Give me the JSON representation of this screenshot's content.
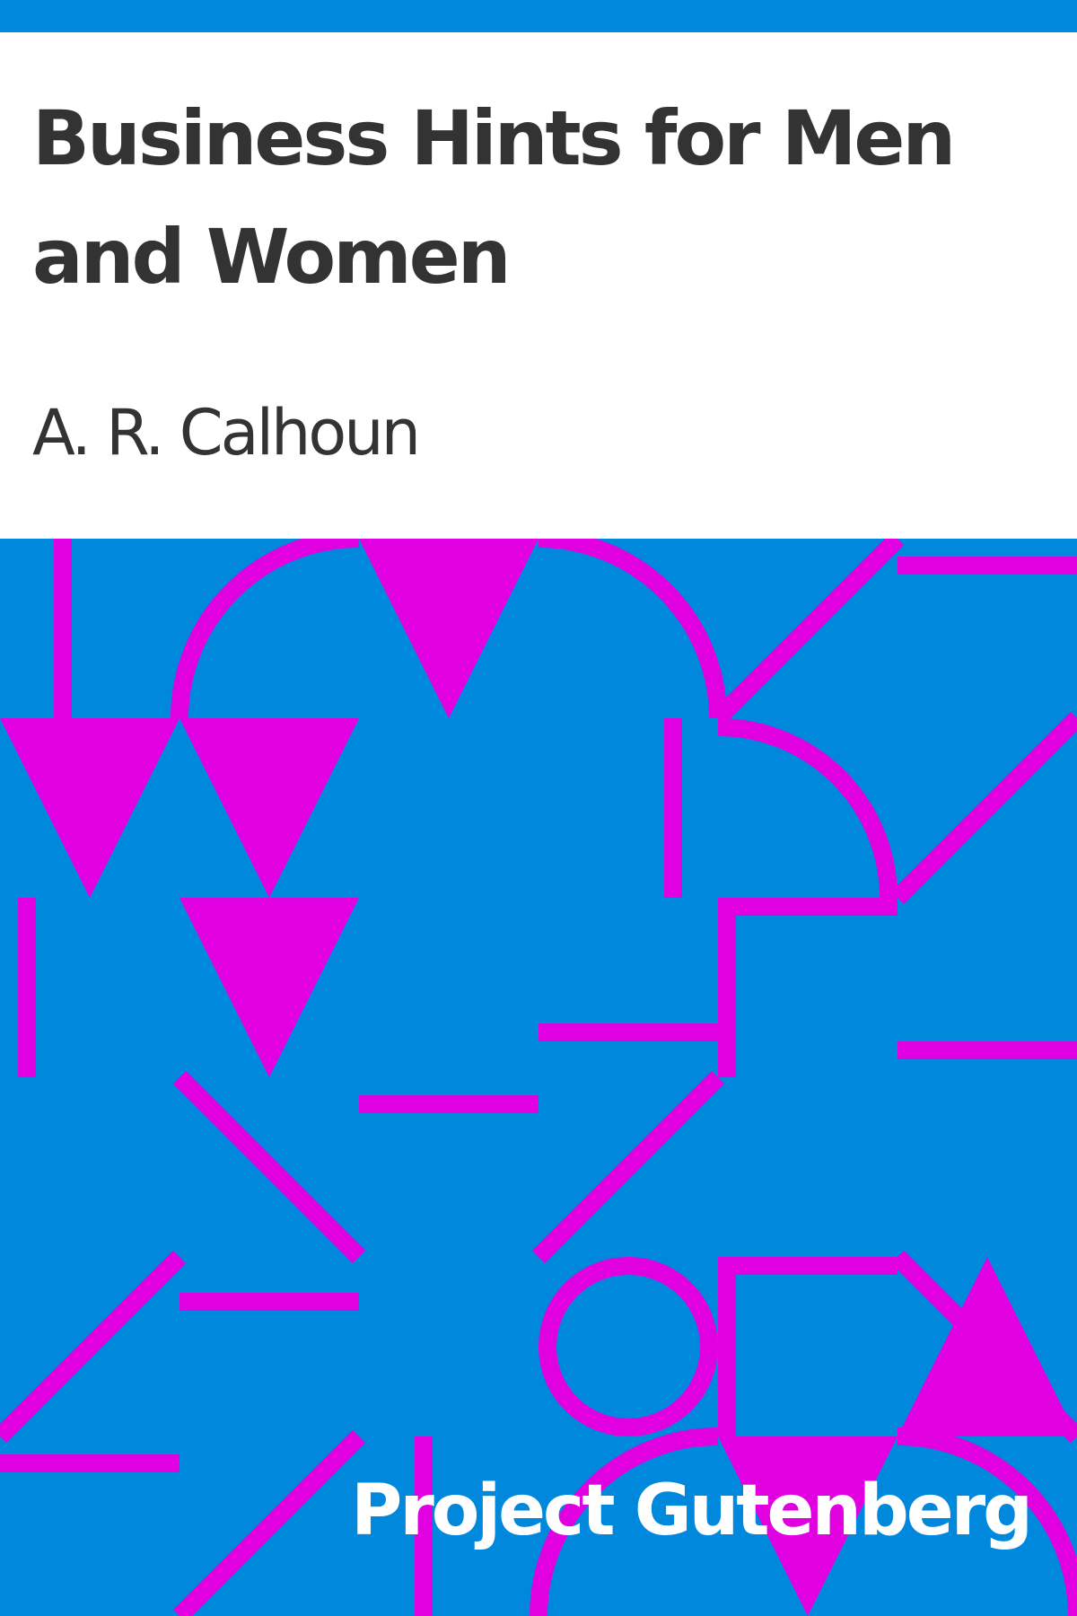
{
  "cover": {
    "title": "Business Hints for Men and Women",
    "author": "A. R. Calhoun",
    "publisher": "Project Gutenberg"
  },
  "colors": {
    "accent": "#0088DD",
    "pattern": "#E000E0",
    "title_text": "#333333",
    "background": "#FFFFFF",
    "brand_text": "#FFFFFF"
  }
}
